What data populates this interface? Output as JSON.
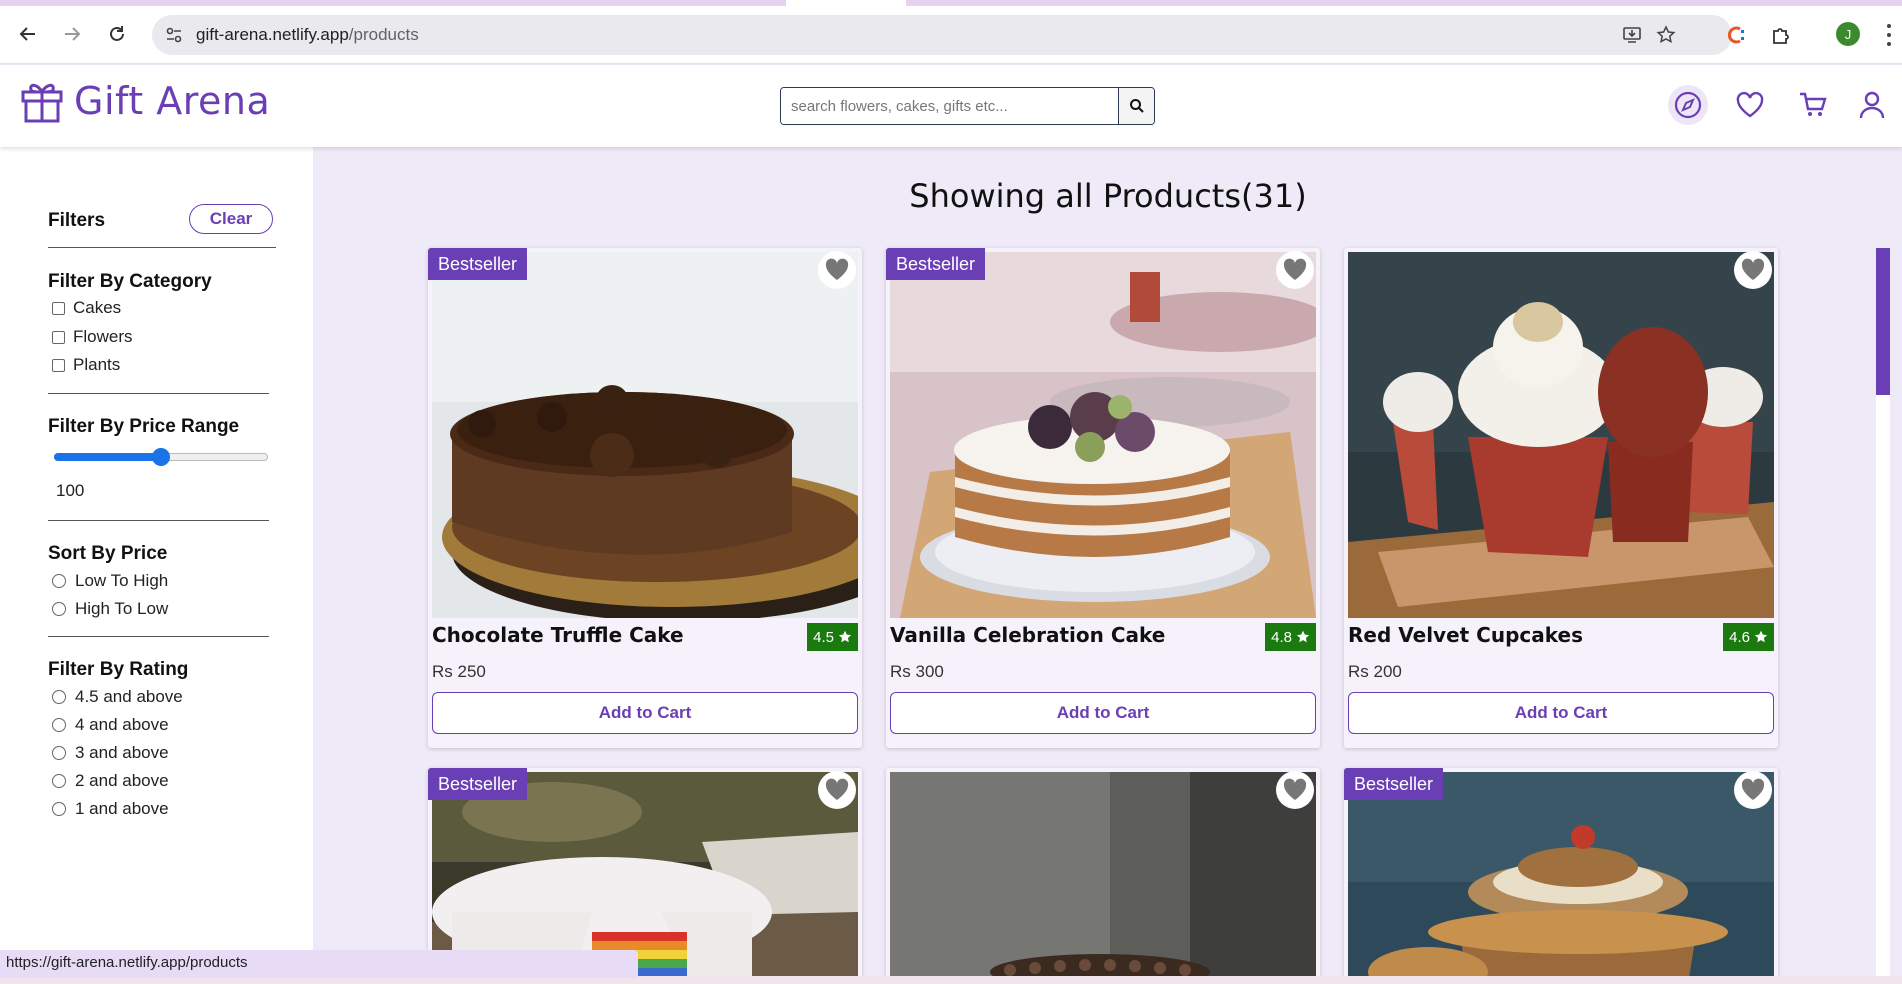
{
  "browser": {
    "url_host": "gift-arena.netlify.app",
    "url_path": "/products",
    "profile_initial": "J",
    "status_url": "https://gift-arena.netlify.app/products"
  },
  "header": {
    "brand": "Gift Arena",
    "search_placeholder": "search flowers, cakes, gifts etc...",
    "icons": [
      "explore-icon",
      "heart-icon",
      "cart-icon",
      "user-icon"
    ]
  },
  "filters": {
    "title": "Filters",
    "clear_label": "Clear",
    "category": {
      "title": "Filter By Category",
      "options": [
        "Cakes",
        "Flowers",
        "Plants"
      ]
    },
    "price_range": {
      "title": "Filter By Price Range",
      "value": "100",
      "slider_fraction": 0.5
    },
    "sort": {
      "title": "Sort By Price",
      "options": [
        "Low To High",
        "High To Low"
      ]
    },
    "rating": {
      "title": "Filter By Rating",
      "options": [
        "4.5 and above",
        "4 and above",
        "3 and above",
        "2 and above",
        "1 and above"
      ]
    }
  },
  "main": {
    "title": "Showing all Products(31)",
    "add_to_cart_label": "Add to Cart",
    "bestseller_label": "Bestseller",
    "products": [
      {
        "name": "Chocolate Truffle Cake",
        "rating": "4.5",
        "price": "Rs 250",
        "bestseller": true
      },
      {
        "name": "Vanilla Celebration Cake",
        "rating": "4.8",
        "price": "Rs 300",
        "bestseller": true
      },
      {
        "name": "Red Velvet Cupcakes",
        "rating": "4.6",
        "price": "Rs 200",
        "bestseller": false
      },
      {
        "bestseller": true
      },
      {
        "bestseller": false
      },
      {
        "bestseller": true
      }
    ]
  },
  "colors": {
    "brand": "#6a3fb5",
    "page_bg": "#efeaf7",
    "rating_green": "#1a7a10",
    "slider_blue": "#1a73e8"
  }
}
